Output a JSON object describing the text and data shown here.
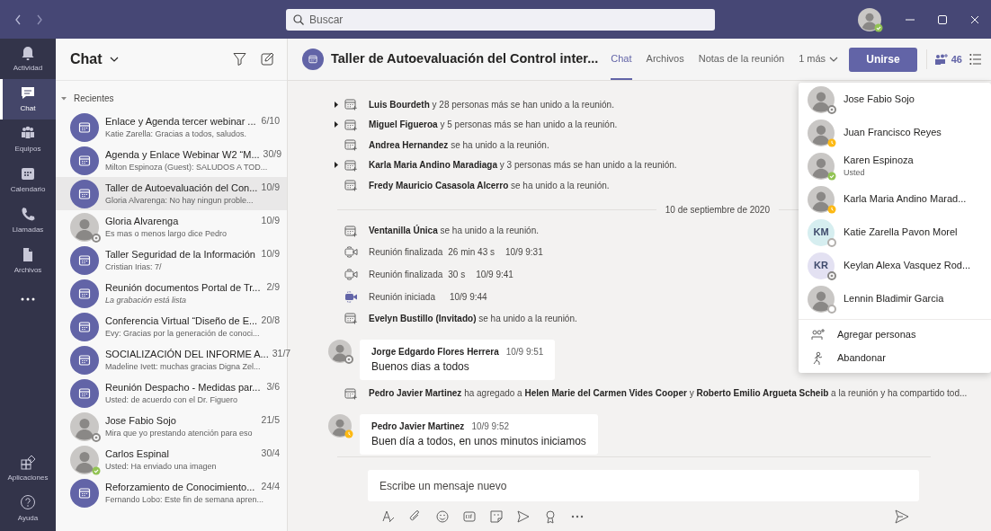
{
  "window": {
    "search_placeholder": "Buscar",
    "user_presence": {
      "kind": "available",
      "color": "#92c353"
    }
  },
  "rail": {
    "items": [
      {
        "label": "Actividad",
        "selected": false
      },
      {
        "label": "Chat",
        "selected": true
      },
      {
        "label": "Equipos",
        "selected": false
      },
      {
        "label": "Calendario",
        "selected": false
      },
      {
        "label": "Llamadas",
        "selected": false
      },
      {
        "label": "Archivos",
        "selected": false
      }
    ],
    "bottom_items": [
      {
        "label": "Aplicaciones"
      },
      {
        "label": "Ayuda"
      }
    ]
  },
  "chat_list": {
    "title": "Chat",
    "section": "Recientes",
    "items": [
      {
        "kind": "meeting",
        "title": "Enlace y Agenda tercer webinar ...",
        "date": "6/10",
        "preview": "Katie Zarella: Gracias a todos, saludos.",
        "italic": false,
        "selected": false
      },
      {
        "kind": "meeting",
        "title": "Agenda y Enlace Webinar W2 “M...",
        "date": "30/9",
        "preview": "Milton Espinoza (Guest): SALUDOS A TOD...",
        "italic": false,
        "selected": false
      },
      {
        "kind": "meeting",
        "title": "Taller de Autoevaluación del Con...",
        "date": "10/9",
        "preview": "Gloria Alvarenga: No hay ningun proble...",
        "italic": false,
        "selected": true
      },
      {
        "kind": "person",
        "presence": {
          "kind": "offline",
          "color": "#8a8886"
        },
        "title": "Gloria Alvarenga",
        "date": "10/9",
        "preview": "Es mas o menos largo dice Pedro",
        "italic": false,
        "selected": false
      },
      {
        "kind": "meeting",
        "title": "Taller Seguridad de la Información",
        "date": "10/9",
        "preview": "Cristian Irias: 7/",
        "italic": false,
        "selected": false
      },
      {
        "kind": "meeting",
        "title": "Reunión documentos Portal de Tr...",
        "date": "2/9",
        "preview": "La grabación está lista",
        "italic": true,
        "selected": false
      },
      {
        "kind": "meeting",
        "title": "Conferencia Virtual “Diseño de E...",
        "date": "20/8",
        "preview": "Evy: Gracias por la generación de conoci...",
        "italic": false,
        "selected": false
      },
      {
        "kind": "meeting",
        "title": "SOCIALIZACIÓN DEL INFORME A...",
        "date": "31/7",
        "preview": "Madeline Ivett: muchas gracias Digna Zel...",
        "italic": false,
        "selected": false
      },
      {
        "kind": "meeting",
        "title": "Reunión Despacho - Medidas par...",
        "date": "3/6",
        "preview": "Usted: de acuerdo con el Dr. Figuero",
        "italic": false,
        "selected": false
      },
      {
        "kind": "person",
        "presence": {
          "kind": "offline",
          "color": "#8a8886"
        },
        "title": "Jose Fabio Sojo",
        "date": "21/5",
        "preview": "Mira que yo prestando atención para eso",
        "italic": false,
        "selected": false
      },
      {
        "kind": "person",
        "presence": {
          "kind": "available",
          "color": "#92c353"
        },
        "title": "Carlos Espinal",
        "date": "30/4",
        "preview": "Usted: Ha enviado una imagen",
        "italic": false,
        "selected": false
      },
      {
        "kind": "meeting",
        "title": "Reforzamiento de Conocimiento...",
        "date": "24/4",
        "preview": "Fernando Lobo: Este fin de semana apren...",
        "italic": false,
        "selected": false
      }
    ]
  },
  "header": {
    "title": "Taller de Autoevaluación del Control inter...",
    "tabs": [
      {
        "label": "Chat",
        "selected": true
      },
      {
        "label": "Archivos",
        "selected": false
      },
      {
        "label": "Notas de la reunión",
        "selected": false
      }
    ],
    "more_tab": "1 más",
    "join_button": "Unirse",
    "participant_count": "46"
  },
  "feed": [
    {
      "kind": "joined",
      "expandable": true,
      "text": "**Luis Bourdeth** y 28 personas más se han unido a la reunión."
    },
    {
      "kind": "joined",
      "expandable": true,
      "text": "**Miguel Figueroa** y 5 personas más se han unido a la reunión."
    },
    {
      "kind": "joined",
      "expandable": false,
      "text": "**Andrea Hernandez** se ha unido a la reunión."
    },
    {
      "kind": "joined",
      "expandable": true,
      "text": "**Karla Maria Andino Maradiaga** y 3 personas más se han unido a la reunión."
    },
    {
      "kind": "joined",
      "expandable": false,
      "text": "**Fredy Mauricio Casasola Alcerro** se ha unido a la reunión."
    },
    {
      "kind": "date",
      "text": "10 de septiembre de 2020"
    },
    {
      "kind": "joined",
      "expandable": false,
      "text": "**Ventanilla Única** se ha unido a la reunión."
    },
    {
      "kind": "ended",
      "label": "Reunión finalizada",
      "duration": "26 min 43 s",
      "time": "10/9 9:31"
    },
    {
      "kind": "ended",
      "label": "Reunión finalizada",
      "duration": "30 s",
      "time": "10/9 9:41"
    },
    {
      "kind": "started",
      "label": "Reunión iniciada",
      "time": "10/9 9:44"
    },
    {
      "kind": "joined",
      "expandable": false,
      "text": "**Evelyn Bustillo (Invitado)** se ha unido a la reunión."
    },
    {
      "kind": "message",
      "author": "Jorge Edgardo Flores Herrera",
      "time": "10/9 9:51",
      "text": "Buenos dias a todos",
      "presence": {
        "kind": "offline",
        "color": "#8a8886"
      }
    },
    {
      "kind": "joined",
      "expandable": false,
      "text": "**Pedro Javier Martinez** ha agregado a **Helen Marie del Carmen Vides Cooper** y **Roberto Emilio Argueta Scheib** a la reunión y ha compartido tod..."
    },
    {
      "kind": "message",
      "author": "Pedro Javier Martinez",
      "time": "10/9 9:52",
      "text": "Buen día a todos, en unos minutos iniciamos",
      "presence": {
        "kind": "away",
        "color": "#fdb913"
      }
    }
  ],
  "compose": {
    "placeholder": "Escribe un mensaje nuevo"
  },
  "participants": {
    "people": [
      {
        "kind": "photo",
        "name": "Jose Fabio Sojo",
        "presence": {
          "kind": "offline",
          "color": "#8a8886"
        }
      },
      {
        "kind": "photo",
        "name": "Juan Francisco Reyes",
        "presence": {
          "kind": "away",
          "color": "#fdb913"
        }
      },
      {
        "kind": "photo",
        "name": "Karen Espinoza",
        "subtitle": "Usted",
        "presence": {
          "kind": "available",
          "color": "#92c353"
        }
      },
      {
        "kind": "photo",
        "name": "Karla Maria Andino Marad...",
        "presence": {
          "kind": "away",
          "color": "#fdb913"
        }
      },
      {
        "kind": "initials",
        "initials": "KM",
        "color": "#d6eef0",
        "name": "Katie Zarella Pavon Morel",
        "presence": {
          "kind": "unknown",
          "color": "#b3b0ad"
        }
      },
      {
        "kind": "initials",
        "initials": "KR",
        "color": "#e3e1f2",
        "name": "Keylan Alexa Vasquez Rod...",
        "presence": {
          "kind": "offline",
          "color": "#8a8886"
        }
      },
      {
        "kind": "photo",
        "name": "Lennin Bladimir Garcia",
        "presence": {
          "kind": "unknown",
          "color": "#b3b0ad"
        }
      }
    ],
    "actions": [
      {
        "label": "Agregar personas"
      },
      {
        "label": "Abandonar"
      }
    ]
  }
}
